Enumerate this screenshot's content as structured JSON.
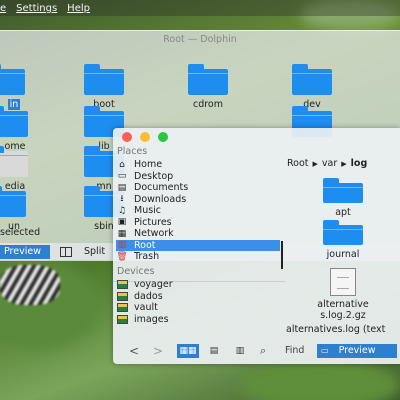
{
  "menubar": {
    "items": [
      "Settings",
      "Help"
    ],
    "partial_left": "e"
  },
  "back_window": {
    "title": "Root — Dolphin",
    "items": [
      "in",
      "boot",
      "cdrom",
      "dev",
      "ome",
      "lib",
      "edia",
      "mn",
      "un",
      "sbin"
    ],
    "status": "selected",
    "preview_label": "Preview",
    "split_label": "Split"
  },
  "front_window": {
    "places_header": "Places",
    "places": [
      {
        "icon": "home-icon",
        "glyph": "⌂",
        "label": "Home"
      },
      {
        "icon": "desktop-icon",
        "glyph": "▭",
        "label": "Desktop"
      },
      {
        "icon": "documents-icon",
        "glyph": "▤",
        "label": "Documents"
      },
      {
        "icon": "downloads-icon",
        "glyph": "⭳",
        "label": "Downloads"
      },
      {
        "icon": "music-icon",
        "glyph": "♫",
        "label": "Music"
      },
      {
        "icon": "pictures-icon",
        "glyph": "▣",
        "label": "Pictures"
      },
      {
        "icon": "network-icon",
        "glyph": "▦",
        "label": "Network"
      },
      {
        "icon": "root-icon",
        "glyph": "▥",
        "label": "Root"
      },
      {
        "icon": "trash-icon",
        "glyph": "🗑",
        "label": "Trash"
      }
    ],
    "selected_place": "Root",
    "devices_header": "Devices",
    "devices": [
      "voyager",
      "dados",
      "vault",
      "images"
    ],
    "breadcrumb": [
      "Root",
      "var",
      "log"
    ],
    "files": [
      {
        "type": "folder",
        "name": "apt"
      },
      {
        "type": "folder",
        "name": "journal"
      },
      {
        "type": "file",
        "name": "alternatives.log.2.gz"
      }
    ],
    "hovered_label": "alternatives.log (text",
    "toolbar": {
      "back": "<",
      "forward": ">",
      "find_label": "Find",
      "preview_label": "Preview"
    },
    "accent": "#3d8ee6"
  }
}
